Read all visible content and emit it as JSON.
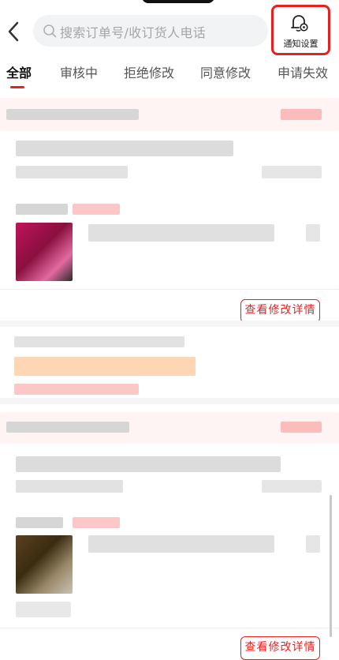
{
  "header": {
    "search_placeholder": "搜索订单号/收订货人电话",
    "notify_label": "通知设置"
  },
  "tabs": [
    "全部",
    "审核中",
    "拒绝修改",
    "同意修改",
    "申请失效"
  ],
  "active_tab_index": 0,
  "orders": [
    {
      "action_label": "查看修改详情"
    },
    {
      "action_label": "查看修改详情"
    }
  ],
  "colors": {
    "accent": "#e8201e",
    "blur_gray": "#d8d8d8",
    "blur_pink": "#fbc7c7",
    "blur_orange": "#ffd6b3"
  },
  "icons": [
    "back-arrow-icon",
    "search-icon",
    "bell-gear-icon"
  ]
}
